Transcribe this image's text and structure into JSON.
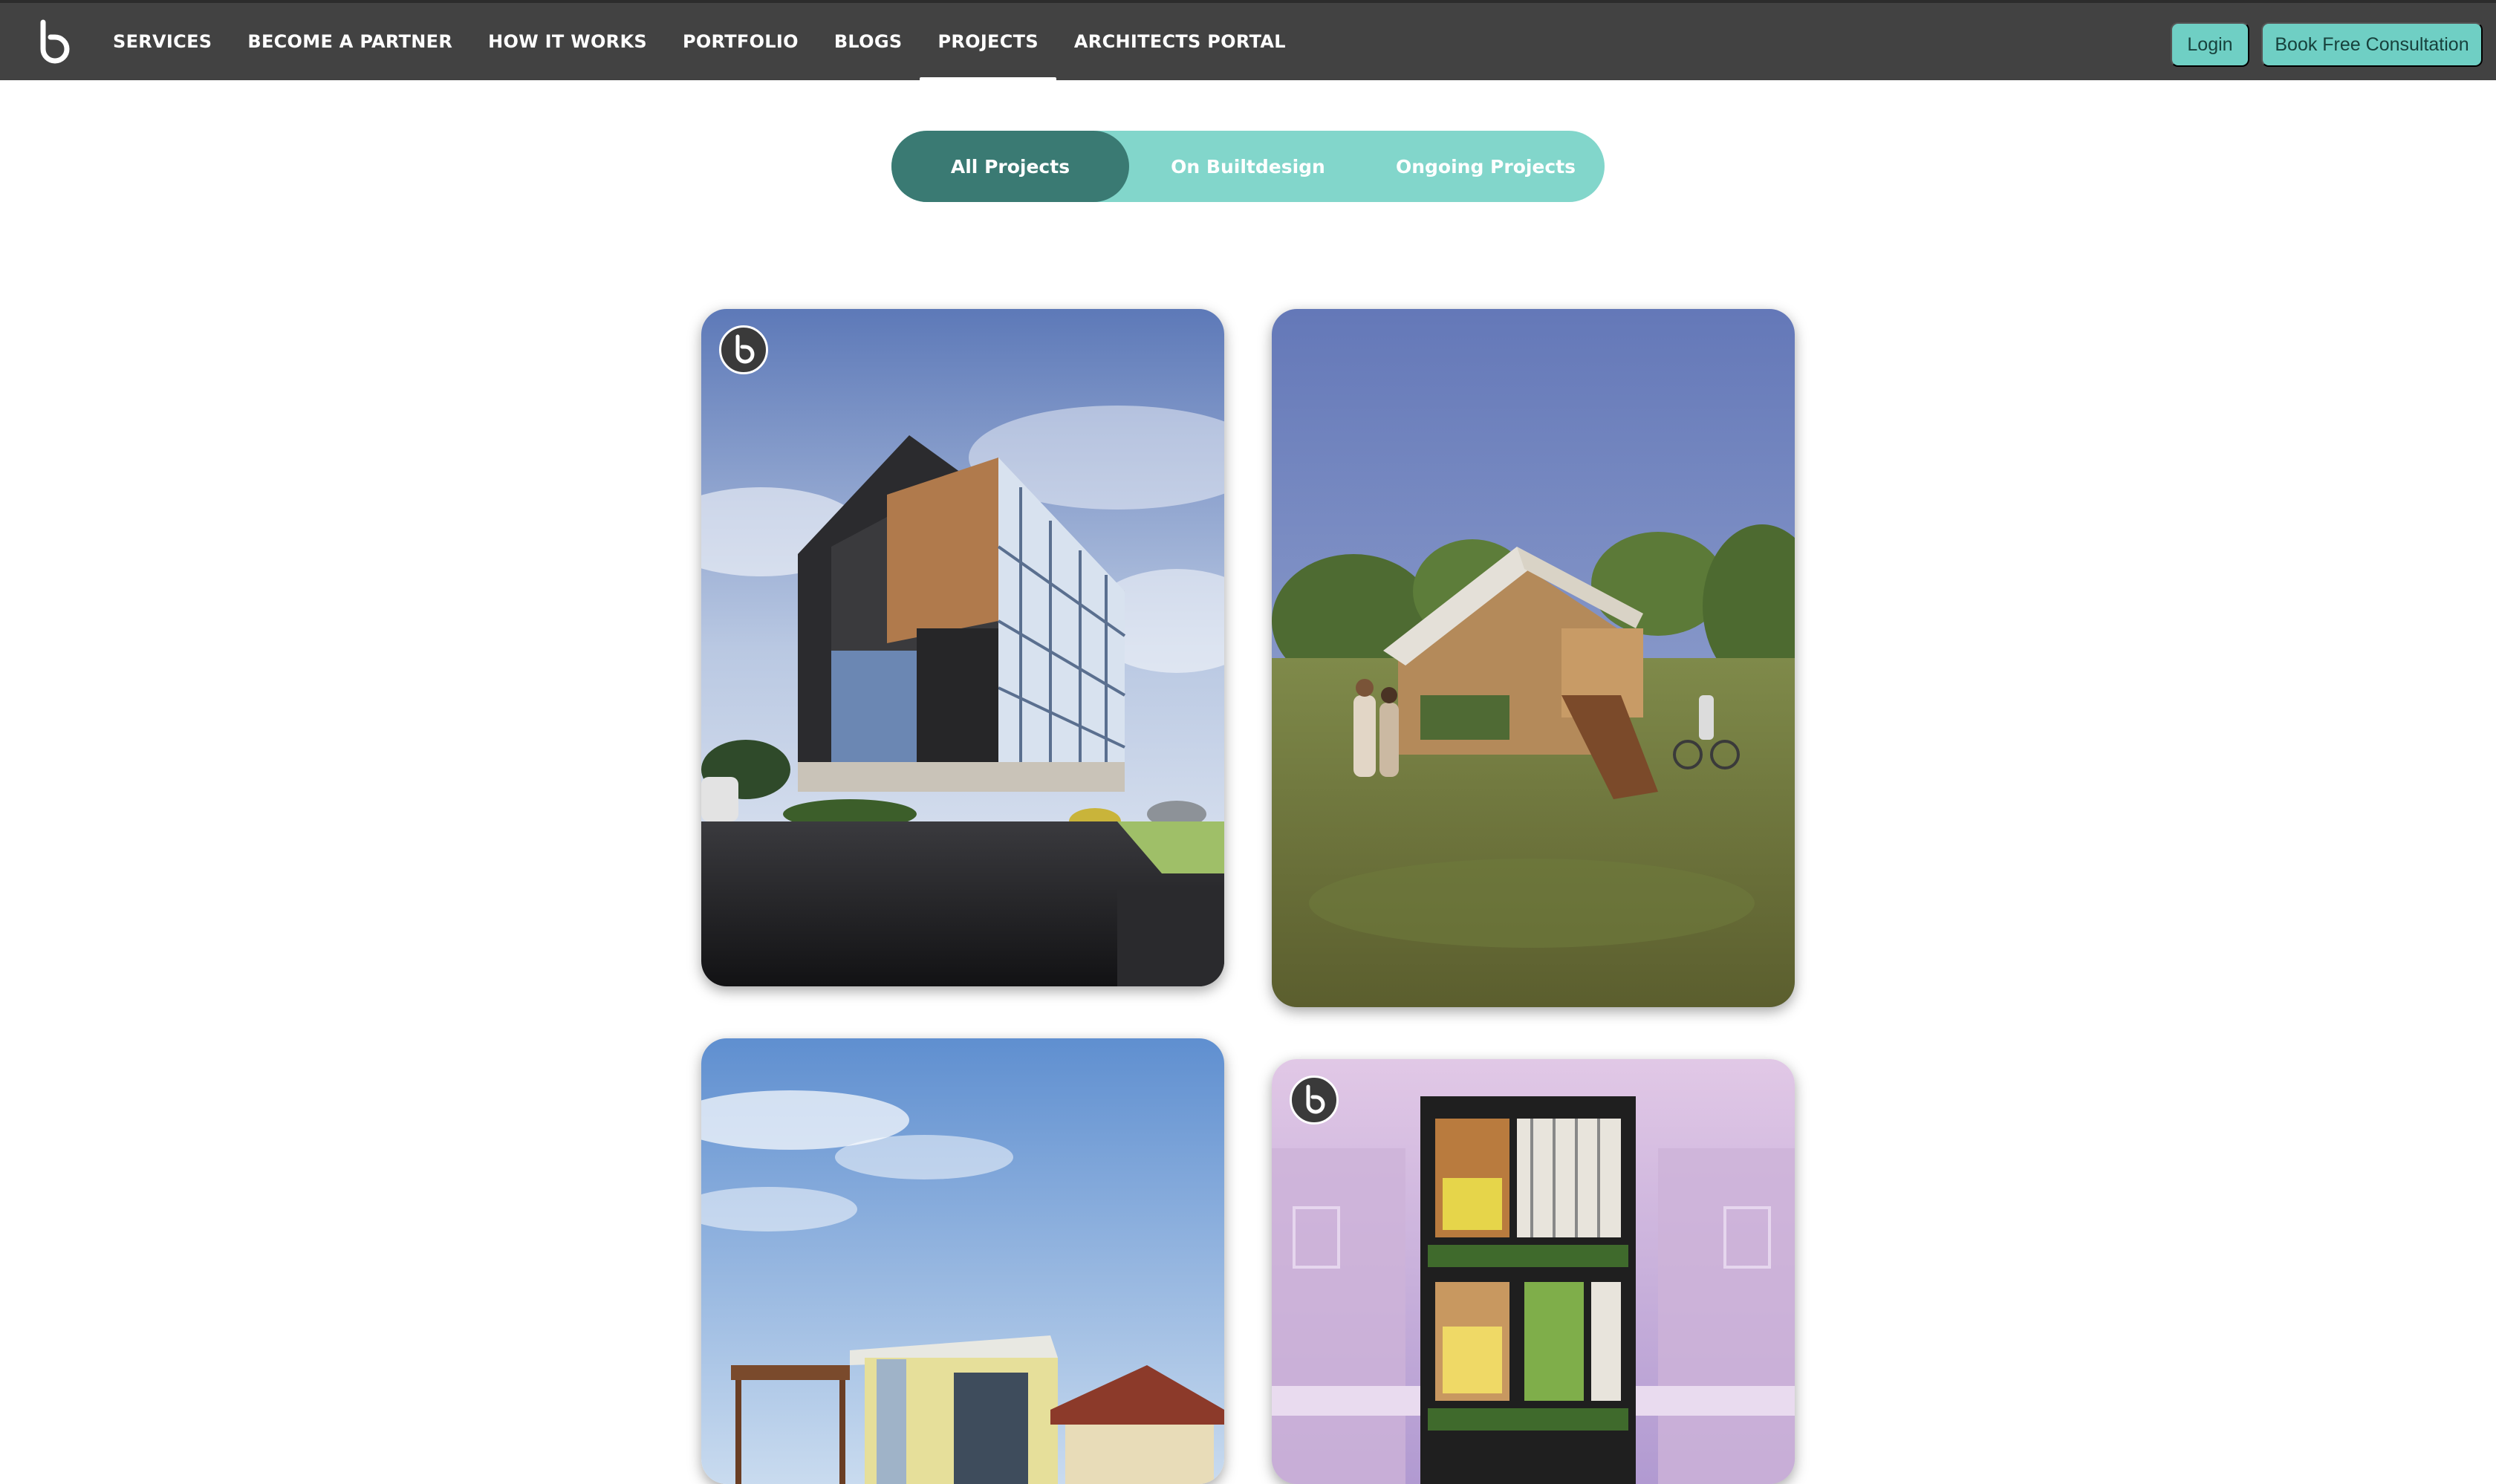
{
  "nav": {
    "logo_icon": "builtdesign-logo-icon",
    "items": [
      {
        "label": "SERVICES"
      },
      {
        "label": "BECOME A PARTNER"
      },
      {
        "label": "HOW IT WORKS"
      },
      {
        "label": "PORTFOLIO"
      },
      {
        "label": "BLOGS"
      },
      {
        "label": "PROJECTS",
        "active": true
      },
      {
        "label": "ARCHITECTS PORTAL"
      }
    ],
    "login_label": "Login",
    "consult_label": "Book Free Consultation"
  },
  "tabs": [
    {
      "label": "All Projects",
      "active": true
    },
    {
      "label": "On Builtdesign"
    },
    {
      "label": "Ongoing Projects"
    }
  ],
  "colors": {
    "topbar": "#424242",
    "accent": "#6fcfc4",
    "tab_active": "#3a7a73",
    "tab_track": "#82d6cb"
  },
  "projects": [
    {
      "subject": "hospital building render",
      "badge_icon": "builtdesign-badge-icon"
    },
    {
      "subject": "wooden cabin with people render"
    },
    {
      "subject": "house with pergola render"
    },
    {
      "subject": "narrow townhouse facade render",
      "badge_icon": "builtdesign-badge-icon"
    }
  ]
}
